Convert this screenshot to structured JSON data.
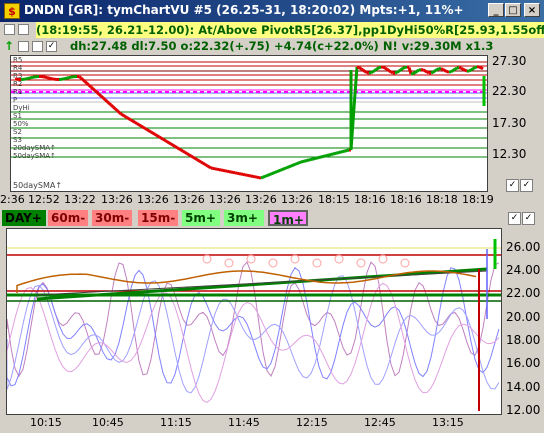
{
  "window": {
    "title": "DNDN [GR]: tymChartVU #5 (26.25-31, 18:20:02) Mpts:+1, 11%+",
    "icon_letter": "$",
    "minimize_label": "_",
    "maximize_label": "□",
    "close_label": "×"
  },
  "toolbar": {
    "up_arrow": "↑",
    "info_line1": "(18:19:55, 26.21-12.00): At/Above PivotR5[26.37],pp1DyHi50%R[25.93,1.55off]",
    "info_line2": "dh:27.48  dl:7.50  o:22.32(+.75)  +4.74(c+22.0%)  N!  v:29.30M x1.3",
    "checkbox_checked": "✓"
  },
  "top_chart": {
    "y_ticks": [
      "27.30",
      "22.30",
      "17.30",
      "12.30"
    ],
    "x_ticks": [
      "2:36",
      "12:52",
      "13:22",
      "13:26",
      "13:26",
      "13:26",
      "13:26",
      "13:26",
      "13:26",
      "18:15",
      "18:16",
      "18:16",
      "18:18",
      "18:19"
    ],
    "overlay_labels": [
      "R5",
      "R4",
      "R3",
      "R2",
      "R1",
      "P",
      "DyHi",
      "S1",
      "50%",
      "S2",
      "S3",
      "20daySMA↑",
      "50daySMA↑"
    ],
    "bottom_label": "50daySMA↑",
    "checkbox_states": [
      "checked",
      "checked"
    ]
  },
  "timeframes": {
    "items": [
      {
        "label": "DAY+",
        "bg": "#008000",
        "fg": "#000000"
      },
      {
        "label": "60m-",
        "bg": "#ff8080",
        "fg": "#800000"
      },
      {
        "label": "30m-",
        "bg": "#ff8080",
        "fg": "#800000"
      },
      {
        "label": "15m-",
        "bg": "#ff8080",
        "fg": "#800000"
      },
      {
        "label": "5m+",
        "bg": "#80ff80",
        "fg": "#004000"
      },
      {
        "label": "3m+",
        "bg": "#80ff80",
        "fg": "#004000"
      },
      {
        "label": "1m+",
        "bg": "#ff80ff",
        "fg": "#004000"
      }
    ]
  },
  "bottom_chart": {
    "y_ticks": [
      "26.00",
      "24.00",
      "22.00",
      "20.00",
      "18.00",
      "16.00",
      "14.00",
      "12.00"
    ],
    "x_ticks": [
      "10:15",
      "10:45",
      "11:15",
      "11:45",
      "12:15",
      "12:45",
      "13:15"
    ]
  },
  "colors": {
    "titlebar": "#0a246a",
    "info_bg": "#ffff80",
    "info_fg": "#006000",
    "up_bar": "#00a000",
    "down_bar": "#e00000"
  }
}
